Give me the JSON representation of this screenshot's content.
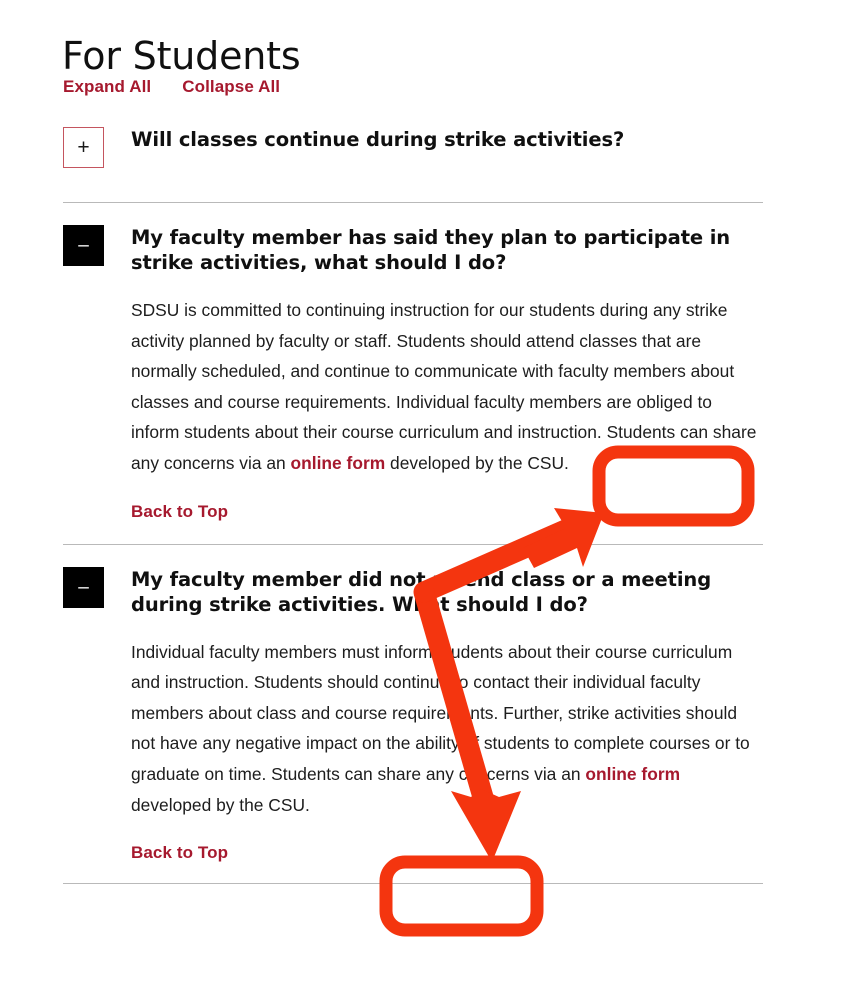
{
  "page": {
    "title": "For Students"
  },
  "controls": {
    "expand_all": "Expand All",
    "collapse_all": "Collapse All"
  },
  "accordion": {
    "items": [
      {
        "icon": "plus-icon",
        "icon_glyph": "+",
        "state": "collapsed",
        "question": "Will classes continue during strike activities?"
      },
      {
        "icon": "minus-icon",
        "icon_glyph": "–",
        "state": "expanded",
        "question": "My faculty member has said they plan to participate in strike activities, what should I do?",
        "answer_part_1": "SDSU is committed to continuing instruction for our students during any strike activity planned by faculty or staff. Students should attend classes that are normally scheduled, and continue to communicate with faculty members about classes and course requirements. Individual faculty members are obliged to inform students about their course curriculum and instruction. Students can share any concerns via an ",
        "answer_link": "online form",
        "answer_part_2": " developed by the CSU.",
        "back_to_top": "Back to Top"
      },
      {
        "icon": "minus-icon",
        "icon_glyph": "–",
        "state": "expanded",
        "question": "My faculty member did not attend class or a meeting during strike activities. What should I do?",
        "answer_part_1": "Individual faculty members must inform students about their course curriculum and instruction. Students should continue to contact their individual faculty members about class and course requirements. Further, strike activities should not have any negative impact on the ability of students to complete courses or to graduate on time. Students can share any concerns via an ",
        "answer_link": "online form",
        "answer_part_2": " developed by the CSU.",
        "back_to_top": "Back to Top"
      }
    ]
  },
  "colors": {
    "link": "#A6192E",
    "annotation": "#F4350F",
    "text": "#1d1d1d",
    "divider": "#b9b9b9",
    "icon_expanded_bg": "#000000"
  },
  "annotations": {
    "highlight_1_label": "online form",
    "highlight_2_label": "online form",
    "arrow_label": "arrow from second online form to first online form"
  }
}
